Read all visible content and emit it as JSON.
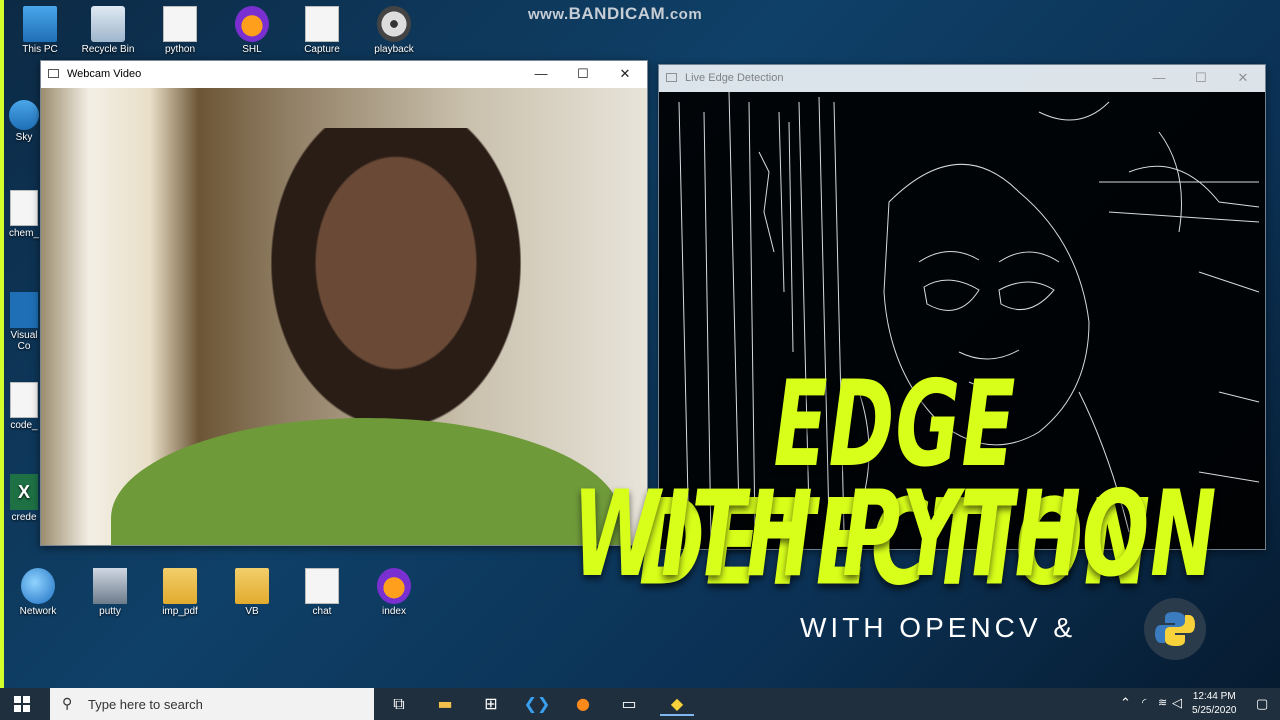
{
  "watermark": {
    "main": "www.",
    "brand": "BANDICAM",
    "suffix": ".com"
  },
  "desktop_icons": [
    {
      "label": "This PC",
      "icon": "this-pc-icon"
    },
    {
      "label": "Recycle Bin",
      "icon": "recycle-bin-icon"
    },
    {
      "label": "python",
      "icon": "text-file-icon"
    },
    {
      "label": "SHL",
      "icon": "firefox-icon"
    },
    {
      "label": "Capture",
      "icon": "image-file-icon"
    },
    {
      "label": "playback",
      "icon": "media-disc-icon"
    },
    {
      "label": "Sky",
      "icon": "skype-icon"
    },
    {
      "label": "chem_",
      "icon": "text-file-icon"
    },
    {
      "label": "Visual Co",
      "icon": "visual-studio-icon"
    },
    {
      "label": "code_",
      "icon": "text-file-icon"
    },
    {
      "label": "crede",
      "icon": "excel-icon"
    },
    {
      "label": "Network",
      "icon": "network-icon"
    },
    {
      "label": "putty",
      "icon": "putty-icon"
    },
    {
      "label": "imp_pdf",
      "icon": "folder-icon"
    },
    {
      "label": "VB",
      "icon": "folder-icon"
    },
    {
      "label": "chat",
      "icon": "text-file-icon"
    },
    {
      "label": "index",
      "icon": "firefox-icon"
    }
  ],
  "windows": {
    "webcam": {
      "title": "Webcam Video",
      "minimize": "—",
      "maximize": "☐",
      "close": "✕"
    },
    "edge": {
      "title": "Live Edge Detection",
      "minimize": "—",
      "maximize": "☐",
      "close": "✕"
    }
  },
  "overlay": {
    "line1": "EDGE DETECTION",
    "line2": "WITH PYTHON",
    "sub": "WITH OPENCV &",
    "accent": "#d8ff1a"
  },
  "taskbar": {
    "search_placeholder": "Type here to search",
    "apps": [
      "task-view-icon",
      "file-explorer-icon",
      "store-icon",
      "vscode-icon",
      "firefox-icon",
      "terminal-icon",
      "python-icon"
    ],
    "time": "12:44 PM",
    "date": "5/25/2020"
  }
}
